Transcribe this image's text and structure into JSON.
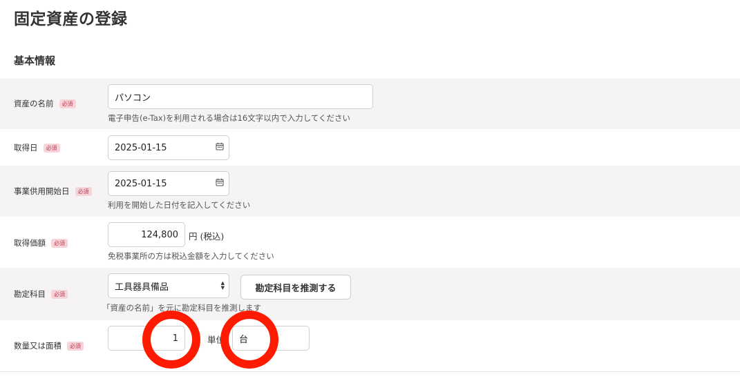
{
  "page": {
    "title": "固定資産の登録",
    "section_title": "基本情報"
  },
  "form": {
    "required_badge": "必須",
    "asset_name": {
      "label": "資産の名前",
      "value": "パソコン",
      "hint": "電子申告(e-Tax)を利用される場合は16文字以内で入力してください"
    },
    "acquisition_date": {
      "label": "取得日",
      "value": "2025-01-15"
    },
    "service_start_date": {
      "label": "事業供用開始日",
      "value": "2025-01-15",
      "hint": "利用を開始した日付を記入してください"
    },
    "acquisition_price": {
      "label": "取得価額",
      "value": "124,800",
      "unit": "円 (税込)",
      "hint": "免税事業所の方は税込金額を入力してください"
    },
    "account_item": {
      "label": "勘定科目",
      "value": "工具器具備品",
      "button": "勘定科目を推測する",
      "hint": "「資産の名前」を元に勘定科目を推測します"
    },
    "quantity": {
      "label": "数量又は面積",
      "value": "1",
      "unit_label": "単位",
      "unit_value": "台"
    }
  },
  "icons": {
    "calendar": "calendar-icon",
    "select": "select-arrows-icon"
  },
  "colors": {
    "annotation": "#ff1a00",
    "badge_bg": "#f7d4da",
    "badge_text": "#c0394f",
    "row_shade": "#f5f3f3"
  }
}
